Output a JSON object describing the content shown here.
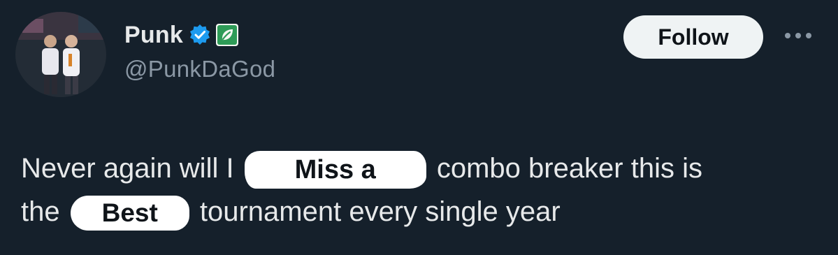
{
  "author": {
    "display_name": "Punk",
    "handle": "@PunkDaGod"
  },
  "badges": {
    "verified": "verified-badge-icon",
    "affiliate": "leaf-org-badge-icon",
    "verified_color": "#1d9bf0",
    "affiliate_color": "#2e9b57"
  },
  "actions": {
    "follow_label": "Follow",
    "more": "more-options-icon"
  },
  "tweet": {
    "line1_start": "Never again will I",
    "line1_redacted": "Miss a",
    "line1_end": "combo breaker this is",
    "line2_start": "the",
    "line2_redacted": "Best",
    "line2_end": "tournament every single year"
  },
  "colors": {
    "background": "#15202b",
    "text": "#e7e9ea",
    "secondary_text": "#8b98a5",
    "follow_bg": "#eff3f4"
  }
}
